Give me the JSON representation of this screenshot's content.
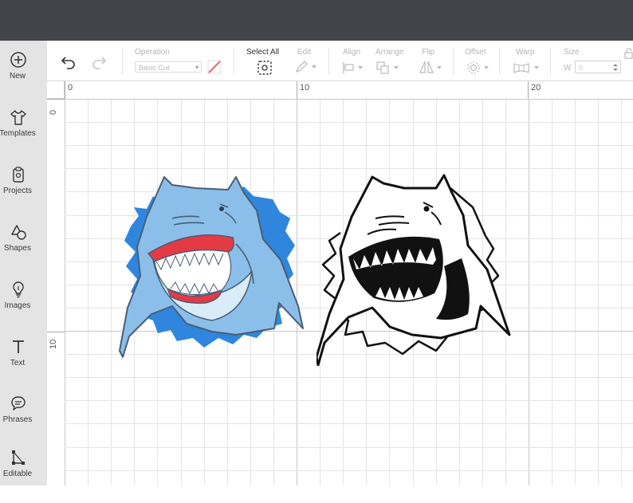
{
  "sidebar": {
    "items": [
      {
        "label": "New",
        "icon": "plus-circle-icon"
      },
      {
        "label": "Templates",
        "icon": "shirt-icon"
      },
      {
        "label": "Projects",
        "icon": "clipboard-icon"
      },
      {
        "label": "Shapes",
        "icon": "shapes-icon"
      },
      {
        "label": "Images",
        "icon": "lightbulb-icon"
      },
      {
        "label": "Text",
        "icon": "text-t-icon"
      },
      {
        "label": "Phrases",
        "icon": "speech-bubble-icon"
      },
      {
        "label": "Editable",
        "icon": "editable-nodes-icon"
      }
    ]
  },
  "toolbar": {
    "operation_label": "Operation",
    "operation_value": "Basic Cut",
    "select_all_label": "Select All",
    "edit_label": "Edit",
    "align_label": "Align",
    "arrange_label": "Arrange",
    "flip_label": "Flip",
    "offset_label": "Offset",
    "warp_label": "Warp",
    "size_label": "Size",
    "size_w_label": "W",
    "size_w_value": "0"
  },
  "ruler": {
    "top": [
      "0",
      "10",
      "20"
    ],
    "left": [
      "0",
      "10"
    ]
  },
  "colors": {
    "titlebar": "#414549",
    "sidebar": "#e4e4e4",
    "shark_light": "#8bbfea",
    "shark_splash": "#2f86dc",
    "shark_mouth": "#e33a44",
    "grid_minor": "#e3e3e3",
    "grid_major": "#c7c7c7"
  }
}
